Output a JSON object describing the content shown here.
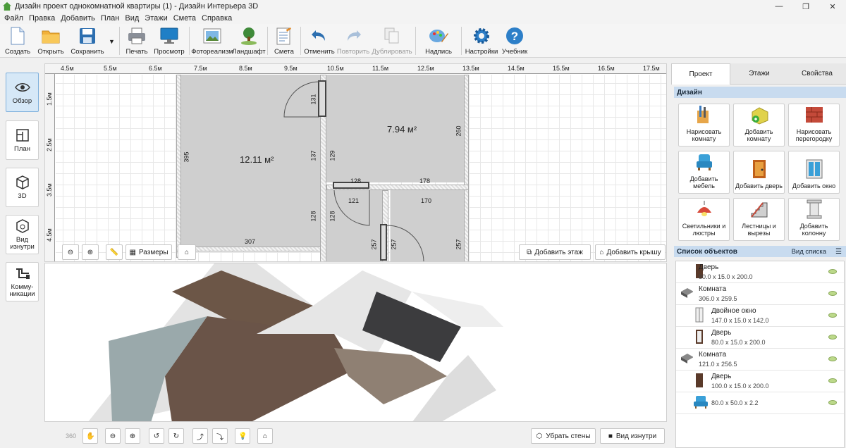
{
  "window": {
    "title": "Дизайн проект однокомнатной квартиры (1) - Дизайн Интерьера 3D"
  },
  "menu": [
    "Файл",
    "Правка",
    "Добавить",
    "План",
    "Вид",
    "Этажи",
    "Смета",
    "Справка"
  ],
  "toolbar": {
    "items": [
      {
        "label": "Создать",
        "icon": "new-file-icon",
        "enabled": true
      },
      {
        "label": "Открыть",
        "icon": "folder-icon",
        "enabled": true
      },
      {
        "label": "Сохранить",
        "icon": "floppy-icon",
        "enabled": true
      },
      {
        "label": "Печать",
        "icon": "printer-icon",
        "enabled": true
      },
      {
        "label": "Просмотр",
        "icon": "monitor-icon",
        "enabled": true
      },
      {
        "label": "Фотореализм",
        "icon": "photo-icon",
        "enabled": true
      },
      {
        "label": "Ландшафт",
        "icon": "tree-icon",
        "enabled": true
      },
      {
        "label": "Смета",
        "icon": "estimate-icon",
        "enabled": true
      },
      {
        "label": "Отменить",
        "icon": "undo-icon",
        "enabled": true
      },
      {
        "label": "Повторить",
        "icon": "redo-icon",
        "enabled": false
      },
      {
        "label": "Дублировать",
        "icon": "duplicate-icon",
        "enabled": false
      },
      {
        "label": "Надпись",
        "icon": "text-label-icon",
        "enabled": true
      },
      {
        "label": "Настройки",
        "icon": "gear-icon",
        "enabled": true
      },
      {
        "label": "Учебник",
        "icon": "help-icon",
        "enabled": true
      }
    ]
  },
  "left_nav": [
    {
      "label": "Обзор",
      "icon": "eye-icon",
      "active": true
    },
    {
      "label": "План",
      "icon": "plan-icon",
      "active": false
    },
    {
      "label": "3D",
      "icon": "cube-icon",
      "active": false
    },
    {
      "label": "Вид изнутри",
      "icon": "inside-view-icon",
      "active": false
    },
    {
      "label": "Комму-никации",
      "icon": "pipes-icon",
      "active": false
    }
  ],
  "ruler": {
    "top": [
      "4.5м",
      "5.5м",
      "6.5м",
      "7.5м",
      "8.5м",
      "9.5м",
      "10.5м",
      "11.5м",
      "12.5м",
      "13.5м",
      "14.5м",
      "15.5м",
      "16.5м",
      "17.5м"
    ],
    "left": [
      "1.5м",
      "2.5м",
      "3.5м",
      "4.5м"
    ]
  },
  "plan": {
    "room1_area": "12.11 м²",
    "room2_area": "7.94 м²",
    "dims": [
      "395",
      "307",
      "137",
      "128",
      "131",
      "129",
      "260",
      "128",
      "178",
      "121",
      "170",
      "128",
      "257",
      "257",
      "257"
    ],
    "buttons": {
      "sizes": "Размеры",
      "add_floor": "Добавить этаж",
      "add_roof": "Добавить крышу"
    }
  },
  "bottom_bar": {
    "remove_walls": "Убрать стены",
    "inside_view": "Вид изнутри",
    "rotate360": "360"
  },
  "right_panel": {
    "tabs": [
      "Проект",
      "Этажи",
      "Свойства"
    ],
    "design_header": "Дизайн",
    "design_buttons": [
      {
        "label": "Нарисовать комнату",
        "icon": "draw-room-icon"
      },
      {
        "label": "Добавить комнату",
        "icon": "add-room-icon"
      },
      {
        "label": "Нарисовать перегородку",
        "icon": "brick-wall-icon"
      },
      {
        "label": "Добавить мебель",
        "icon": "armchair-icon"
      },
      {
        "label": "Добавить дверь",
        "icon": "door-icon"
      },
      {
        "label": "Добавить окно",
        "icon": "window-icon"
      },
      {
        "label": "Светильники и люстры",
        "icon": "lamp-icon"
      },
      {
        "label": "Лестницы и вырезы",
        "icon": "stairs-icon"
      },
      {
        "label": "Добавить колонну",
        "icon": "column-icon"
      }
    ],
    "objects_header": "Список объектов",
    "view_list": "Вид списка",
    "objects": [
      {
        "name": "Дверь",
        "size": "80.0 x 15.0 x 200.0",
        "icon": "door-icon",
        "indent": false
      },
      {
        "name": "Комната",
        "size": "306.0 x 259.5",
        "icon": "room-icon",
        "indent": false
      },
      {
        "name": "Двойное окно",
        "size": "147.0 x 15.0 x 142.0",
        "icon": "window-icon",
        "indent": true
      },
      {
        "name": "Дверь",
        "size": "80.0 x 15.0 x 200.0",
        "icon": "door-icon",
        "indent": true
      },
      {
        "name": "Комната",
        "size": "121.0 x 256.5",
        "icon": "room-icon",
        "indent": false
      },
      {
        "name": "Дверь",
        "size": "100.0 x 15.0 x 200.0",
        "icon": "door-icon",
        "indent": true
      },
      {
        "name": "",
        "size": "80.0 x 50.0 x 2.2",
        "icon": "armchair-icon",
        "indent": true
      }
    ]
  }
}
